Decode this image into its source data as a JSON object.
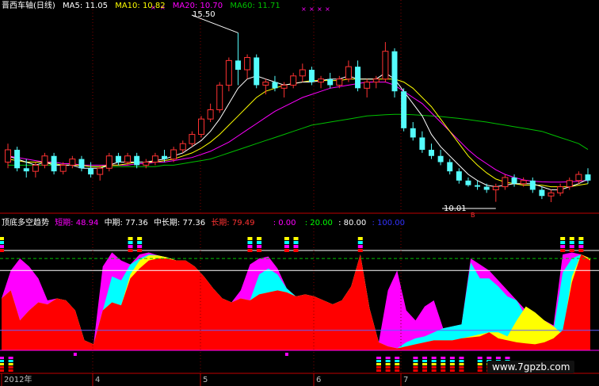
{
  "main_header": {
    "title": "晋西车轴(日线)",
    "ma5": "MA5: 11.05",
    "ma10": "MA10: 10.82",
    "ma20": "MA20: 10.70",
    "ma60": "MA60: 11.71"
  },
  "annotations": {
    "high": "15.50",
    "low": "10.01",
    "marker_b": "B"
  },
  "indicator_header": {
    "title": "顶底多空趋势",
    "short": "短期: 48.94",
    "mid": "中期: 77.36",
    "midlong": "中长期: 77.36",
    "long": "长期: 79.49",
    "l0": ": 0.00",
    "l20": ": 20.00",
    "l80": ": 80.00",
    "l100": ": 100.00"
  },
  "axis": {
    "year": "2012年",
    "m4": "4",
    "m5": "5",
    "m6": "6",
    "m7": "7"
  },
  "watermark": "www.7gpzb.com",
  "colors": {
    "bg": "#000000",
    "up": "#ff3232",
    "down": "#54fcfc",
    "ma5": "#ffffff",
    "ma10": "#ffff00",
    "ma20": "#ff00ff",
    "ma60": "#00c000",
    "short": "#ff0000",
    "mid": "#ffff00",
    "midlong": "#00ffff",
    "long": "#ff00ff"
  },
  "chart_data": [
    {
      "type": "candlestick",
      "ylim": [
        10,
        16
      ],
      "ohlc": [
        [
          11.3,
          11.9,
          11.1,
          11.7
        ],
        [
          11.7,
          11.8,
          11.0,
          11.1
        ],
        [
          11.1,
          11.4,
          10.8,
          11.0
        ],
        [
          11.0,
          11.3,
          10.8,
          11.2
        ],
        [
          11.2,
          11.6,
          11.1,
          11.5
        ],
        [
          11.5,
          11.6,
          10.9,
          11.0
        ],
        [
          11.0,
          11.3,
          10.9,
          11.2
        ],
        [
          11.2,
          11.5,
          11.1,
          11.4
        ],
        [
          11.4,
          11.5,
          11.0,
          11.1
        ],
        [
          11.1,
          11.3,
          10.8,
          10.9
        ],
        [
          10.9,
          11.2,
          10.7,
          11.1
        ],
        [
          11.1,
          11.6,
          11.0,
          11.5
        ],
        [
          11.5,
          11.6,
          11.2,
          11.3
        ],
        [
          11.3,
          11.6,
          11.2,
          11.5
        ],
        [
          11.5,
          11.6,
          11.1,
          11.2
        ],
        [
          11.2,
          11.4,
          11.1,
          11.3
        ],
        [
          11.3,
          11.6,
          11.2,
          11.5
        ],
        [
          11.5,
          11.7,
          11.3,
          11.4
        ],
        [
          11.4,
          11.8,
          11.3,
          11.7
        ],
        [
          11.7,
          12.0,
          11.6,
          11.9
        ],
        [
          11.9,
          12.3,
          11.8,
          12.2
        ],
        [
          12.2,
          12.8,
          12.1,
          12.7
        ],
        [
          12.7,
          13.2,
          12.6,
          13.0
        ],
        [
          13.0,
          13.9,
          12.9,
          13.8
        ],
        [
          13.8,
          14.7,
          13.6,
          14.6
        ],
        [
          14.6,
          15.5,
          13.8,
          14.3
        ],
        [
          14.3,
          14.8,
          14.0,
          14.7
        ],
        [
          14.7,
          14.8,
          13.7,
          13.8
        ],
        [
          13.8,
          14.0,
          13.5,
          13.9
        ],
        [
          13.9,
          14.1,
          13.6,
          13.7
        ],
        [
          13.7,
          13.9,
          13.4,
          13.8
        ],
        [
          13.8,
          14.2,
          13.7,
          14.1
        ],
        [
          14.1,
          14.5,
          13.9,
          14.3
        ],
        [
          14.3,
          14.4,
          13.8,
          13.9
        ],
        [
          13.9,
          14.1,
          13.7,
          14.0
        ],
        [
          14.0,
          14.2,
          13.7,
          13.8
        ],
        [
          13.8,
          14.1,
          13.7,
          14.0
        ],
        [
          14.0,
          14.6,
          13.9,
          14.4
        ],
        [
          14.4,
          14.6,
          13.6,
          13.7
        ],
        [
          13.7,
          14.0,
          13.4,
          13.9
        ],
        [
          13.9,
          14.1,
          13.7,
          14.0
        ],
        [
          14.0,
          15.2,
          13.9,
          14.9
        ],
        [
          14.9,
          15.0,
          13.4,
          13.6
        ],
        [
          13.6,
          13.7,
          12.3,
          12.4
        ],
        [
          12.4,
          12.6,
          12.0,
          12.1
        ],
        [
          12.1,
          12.3,
          11.6,
          11.7
        ],
        [
          11.7,
          11.9,
          11.4,
          11.5
        ],
        [
          11.5,
          11.7,
          11.2,
          11.3
        ],
        [
          11.3,
          11.4,
          10.9,
          11.0
        ],
        [
          11.0,
          11.1,
          10.6,
          10.7
        ],
        [
          10.7,
          10.8,
          10.5,
          10.55
        ],
        [
          10.55,
          10.7,
          10.4,
          10.5
        ],
        [
          10.5,
          10.6,
          10.3,
          10.4
        ],
        [
          10.4,
          10.6,
          10.01,
          10.5
        ],
        [
          10.5,
          10.9,
          10.4,
          10.8
        ],
        [
          10.8,
          10.9,
          10.5,
          10.6
        ],
        [
          10.6,
          10.8,
          10.5,
          10.7
        ],
        [
          10.7,
          10.8,
          10.3,
          10.4
        ],
        [
          10.4,
          10.5,
          10.1,
          10.2
        ],
        [
          10.2,
          10.4,
          10.0,
          10.3
        ],
        [
          10.3,
          10.6,
          10.2,
          10.5
        ],
        [
          10.5,
          10.8,
          10.4,
          10.7
        ],
        [
          10.7,
          11.0,
          10.6,
          10.9
        ],
        [
          10.9,
          11.1,
          10.6,
          10.7
        ]
      ],
      "ma5": [
        11.5,
        11.4,
        11.3,
        11.2,
        11.3,
        11.2,
        11.2,
        11.2,
        11.1,
        11.1,
        11.1,
        11.2,
        11.3,
        11.3,
        11.3,
        11.3,
        11.35,
        11.4,
        11.5,
        11.6,
        11.8,
        12.0,
        12.3,
        12.7,
        13.2,
        13.7,
        14.0,
        14.1,
        14.0,
        13.9,
        13.8,
        13.85,
        13.9,
        13.9,
        13.95,
        14.0,
        14.0,
        14.1,
        14.0,
        14.0,
        14.0,
        14.2,
        14.0,
        13.6,
        13.2,
        12.8,
        12.2,
        11.8,
        11.5,
        11.2,
        10.9,
        10.7,
        10.55,
        10.5,
        10.55,
        10.6,
        10.6,
        10.6,
        10.5,
        10.4,
        10.4,
        10.5,
        10.6,
        10.75
      ],
      "ma10": [
        11.4,
        11.35,
        11.3,
        11.3,
        11.3,
        11.25,
        11.2,
        11.2,
        11.2,
        11.15,
        11.15,
        11.2,
        11.2,
        11.25,
        11.3,
        11.3,
        11.3,
        11.35,
        11.4,
        11.5,
        11.6,
        11.75,
        11.95,
        12.2,
        12.5,
        12.8,
        13.1,
        13.4,
        13.6,
        13.7,
        13.8,
        13.85,
        13.9,
        13.95,
        13.95,
        13.95,
        13.95,
        14.0,
        14.0,
        14.0,
        14.0,
        14.0,
        14.0,
        13.9,
        13.7,
        13.4,
        13.1,
        12.7,
        12.3,
        11.9,
        11.5,
        11.2,
        10.95,
        10.75,
        10.65,
        10.6,
        10.55,
        10.55,
        10.55,
        10.5,
        10.5,
        10.5,
        10.55,
        10.6
      ],
      "ma20": [
        11.5,
        11.45,
        11.4,
        11.35,
        11.3,
        11.3,
        11.25,
        11.25,
        11.2,
        11.2,
        11.2,
        11.2,
        11.2,
        11.2,
        11.25,
        11.25,
        11.3,
        11.3,
        11.35,
        11.4,
        11.45,
        11.55,
        11.65,
        11.8,
        11.95,
        12.15,
        12.35,
        12.55,
        12.75,
        12.95,
        13.1,
        13.25,
        13.4,
        13.5,
        13.6,
        13.7,
        13.75,
        13.8,
        13.85,
        13.9,
        13.9,
        13.9,
        13.8,
        13.6,
        13.4,
        13.2,
        12.9,
        12.6,
        12.3,
        12.0,
        11.7,
        11.45,
        11.25,
        11.05,
        10.9,
        10.8,
        10.72,
        10.68,
        10.66,
        10.65,
        10.65,
        10.66,
        10.68,
        10.7
      ],
      "ma60": [
        11.2,
        11.2,
        11.2,
        11.2,
        11.2,
        11.2,
        11.2,
        11.2,
        11.2,
        11.15,
        11.15,
        11.15,
        11.15,
        11.15,
        11.15,
        11.15,
        11.15,
        11.2,
        11.2,
        11.25,
        11.3,
        11.35,
        11.4,
        11.5,
        11.6,
        11.7,
        11.8,
        11.9,
        12.0,
        12.1,
        12.2,
        12.3,
        12.4,
        12.5,
        12.55,
        12.6,
        12.65,
        12.7,
        12.75,
        12.8,
        12.82,
        12.84,
        12.85,
        12.85,
        12.84,
        12.82,
        12.8,
        12.78,
        12.75,
        12.72,
        12.68,
        12.64,
        12.6,
        12.55,
        12.5,
        12.45,
        12.4,
        12.35,
        12.3,
        12.2,
        12.1,
        12.0,
        11.9,
        11.71
      ]
    },
    {
      "type": "area",
      "ylim": [
        0,
        100
      ],
      "hlines": [
        0,
        20,
        80,
        100
      ],
      "series": [
        {
          "name": "短期",
          "values": [
            52,
            60,
            30,
            40,
            48,
            46,
            52,
            50,
            40,
            10,
            6,
            40,
            48,
            45,
            72,
            82,
            90,
            92,
            92,
            90,
            90,
            84,
            74,
            62,
            52,
            48,
            52,
            50,
            56,
            58,
            60,
            58,
            54,
            56,
            54,
            50,
            46,
            50,
            64,
            96,
            42,
            8,
            4,
            2,
            4,
            6,
            8,
            10,
            10,
            10,
            12,
            13,
            14,
            18,
            12,
            10,
            8,
            7,
            6,
            8,
            12,
            20,
            68,
            96,
            90
          ]
        },
        {
          "name": "中期",
          "values": [
            52,
            60,
            30,
            40,
            48,
            46,
            52,
            50,
            40,
            10,
            6,
            40,
            48,
            45,
            76,
            90,
            95,
            95,
            93,
            90,
            90,
            84,
            74,
            62,
            52,
            48,
            52,
            50,
            56,
            58,
            60,
            58,
            54,
            56,
            54,
            50,
            46,
            50,
            64,
            96,
            42,
            8,
            4,
            2,
            4,
            6,
            8,
            10,
            10,
            10,
            12,
            14,
            16,
            18,
            18,
            14,
            30,
            44,
            38,
            30,
            24,
            16,
            74,
            96,
            92
          ]
        },
        {
          "name": "中长期",
          "values": [
            52,
            60,
            30,
            40,
            48,
            46,
            52,
            50,
            40,
            10,
            6,
            40,
            74,
            70,
            86,
            92,
            96,
            95,
            93,
            90,
            90,
            84,
            74,
            62,
            52,
            48,
            52,
            50,
            76,
            82,
            76,
            62,
            54,
            56,
            54,
            50,
            46,
            50,
            64,
            96,
            42,
            8,
            4,
            2,
            8,
            12,
            14,
            18,
            22,
            24,
            26,
            88,
            72,
            72,
            64,
            54,
            50,
            34,
            30,
            26,
            20,
            78,
            92,
            96
          ]
        },
        {
          "name": "长期",
          "values": [
            52,
            80,
            92,
            84,
            72,
            50,
            52,
            50,
            40,
            10,
            6,
            84,
            98,
            90,
            86,
            96,
            98,
            95,
            93,
            90,
            90,
            84,
            74,
            62,
            52,
            48,
            60,
            86,
            92,
            94,
            82,
            62,
            54,
            56,
            54,
            50,
            46,
            50,
            64,
            96,
            42,
            8,
            60,
            80,
            40,
            30,
            44,
            50,
            22,
            24,
            26,
            92,
            86,
            80,
            70,
            60,
            50,
            40,
            35,
            30,
            25,
            96,
            98,
            96,
            92
          ]
        }
      ]
    }
  ]
}
